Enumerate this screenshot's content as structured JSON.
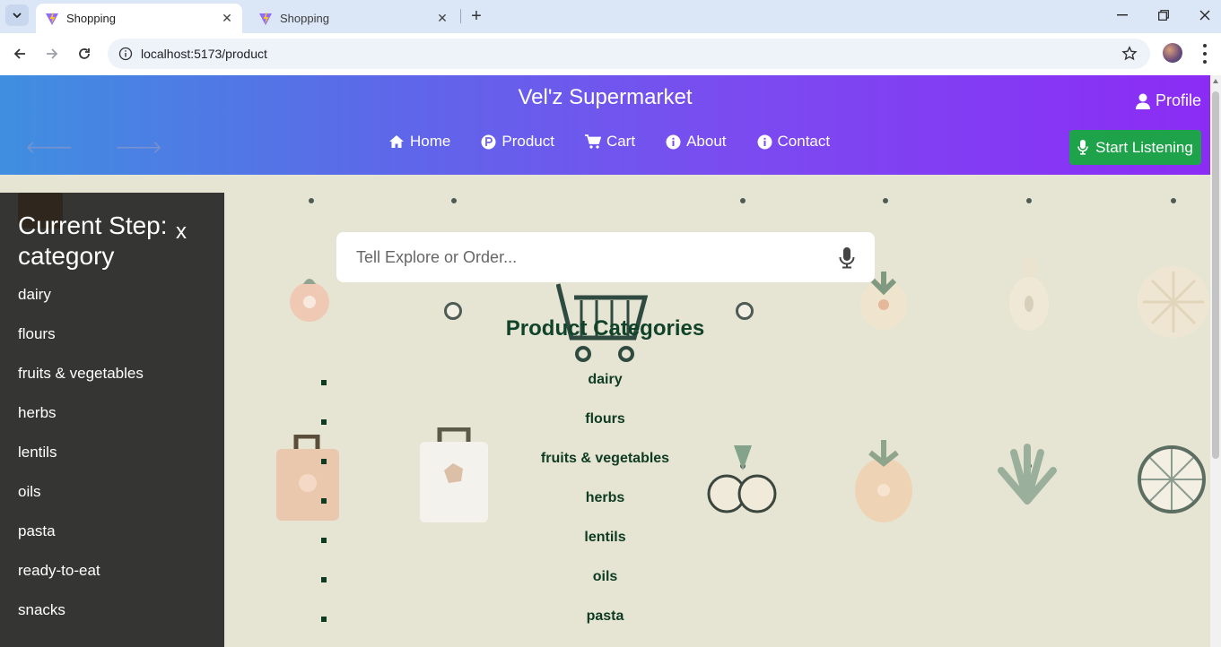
{
  "browser": {
    "tabs": [
      {
        "title": "Shopping",
        "active": true
      },
      {
        "title": "Shopping",
        "active": false
      }
    ],
    "url": "localhost:5173/product"
  },
  "header": {
    "brand": "Vel'z Supermarket",
    "profile": "Profile",
    "nav": [
      {
        "label": "Home",
        "icon": "home-icon"
      },
      {
        "label": "Product",
        "icon": "product-icon"
      },
      {
        "label": "Cart",
        "icon": "cart-icon"
      },
      {
        "label": "About",
        "icon": "info-icon"
      },
      {
        "label": "Contact",
        "icon": "info-icon"
      }
    ],
    "listen_button": "Start Listening"
  },
  "search": {
    "placeholder": "Tell Explore or Order..."
  },
  "categories": {
    "title": "Product Categories",
    "items": [
      "dairy",
      "flours",
      "fruits & vegetables",
      "herbs",
      "lentils",
      "oils",
      "pasta"
    ]
  },
  "sidebar": {
    "step_label": "Current Step:",
    "step_value": "category",
    "close": "x",
    "items": [
      "dairy",
      "flours",
      "fruits & vegetables",
      "herbs",
      "lentils",
      "oils",
      "pasta",
      "ready-to-eat",
      "snacks"
    ]
  },
  "colors": {
    "header_start": "#3f8fe0",
    "header_end": "#8b2cf5",
    "listen_button": "#1fa34a",
    "category_text": "#0e3b22"
  }
}
